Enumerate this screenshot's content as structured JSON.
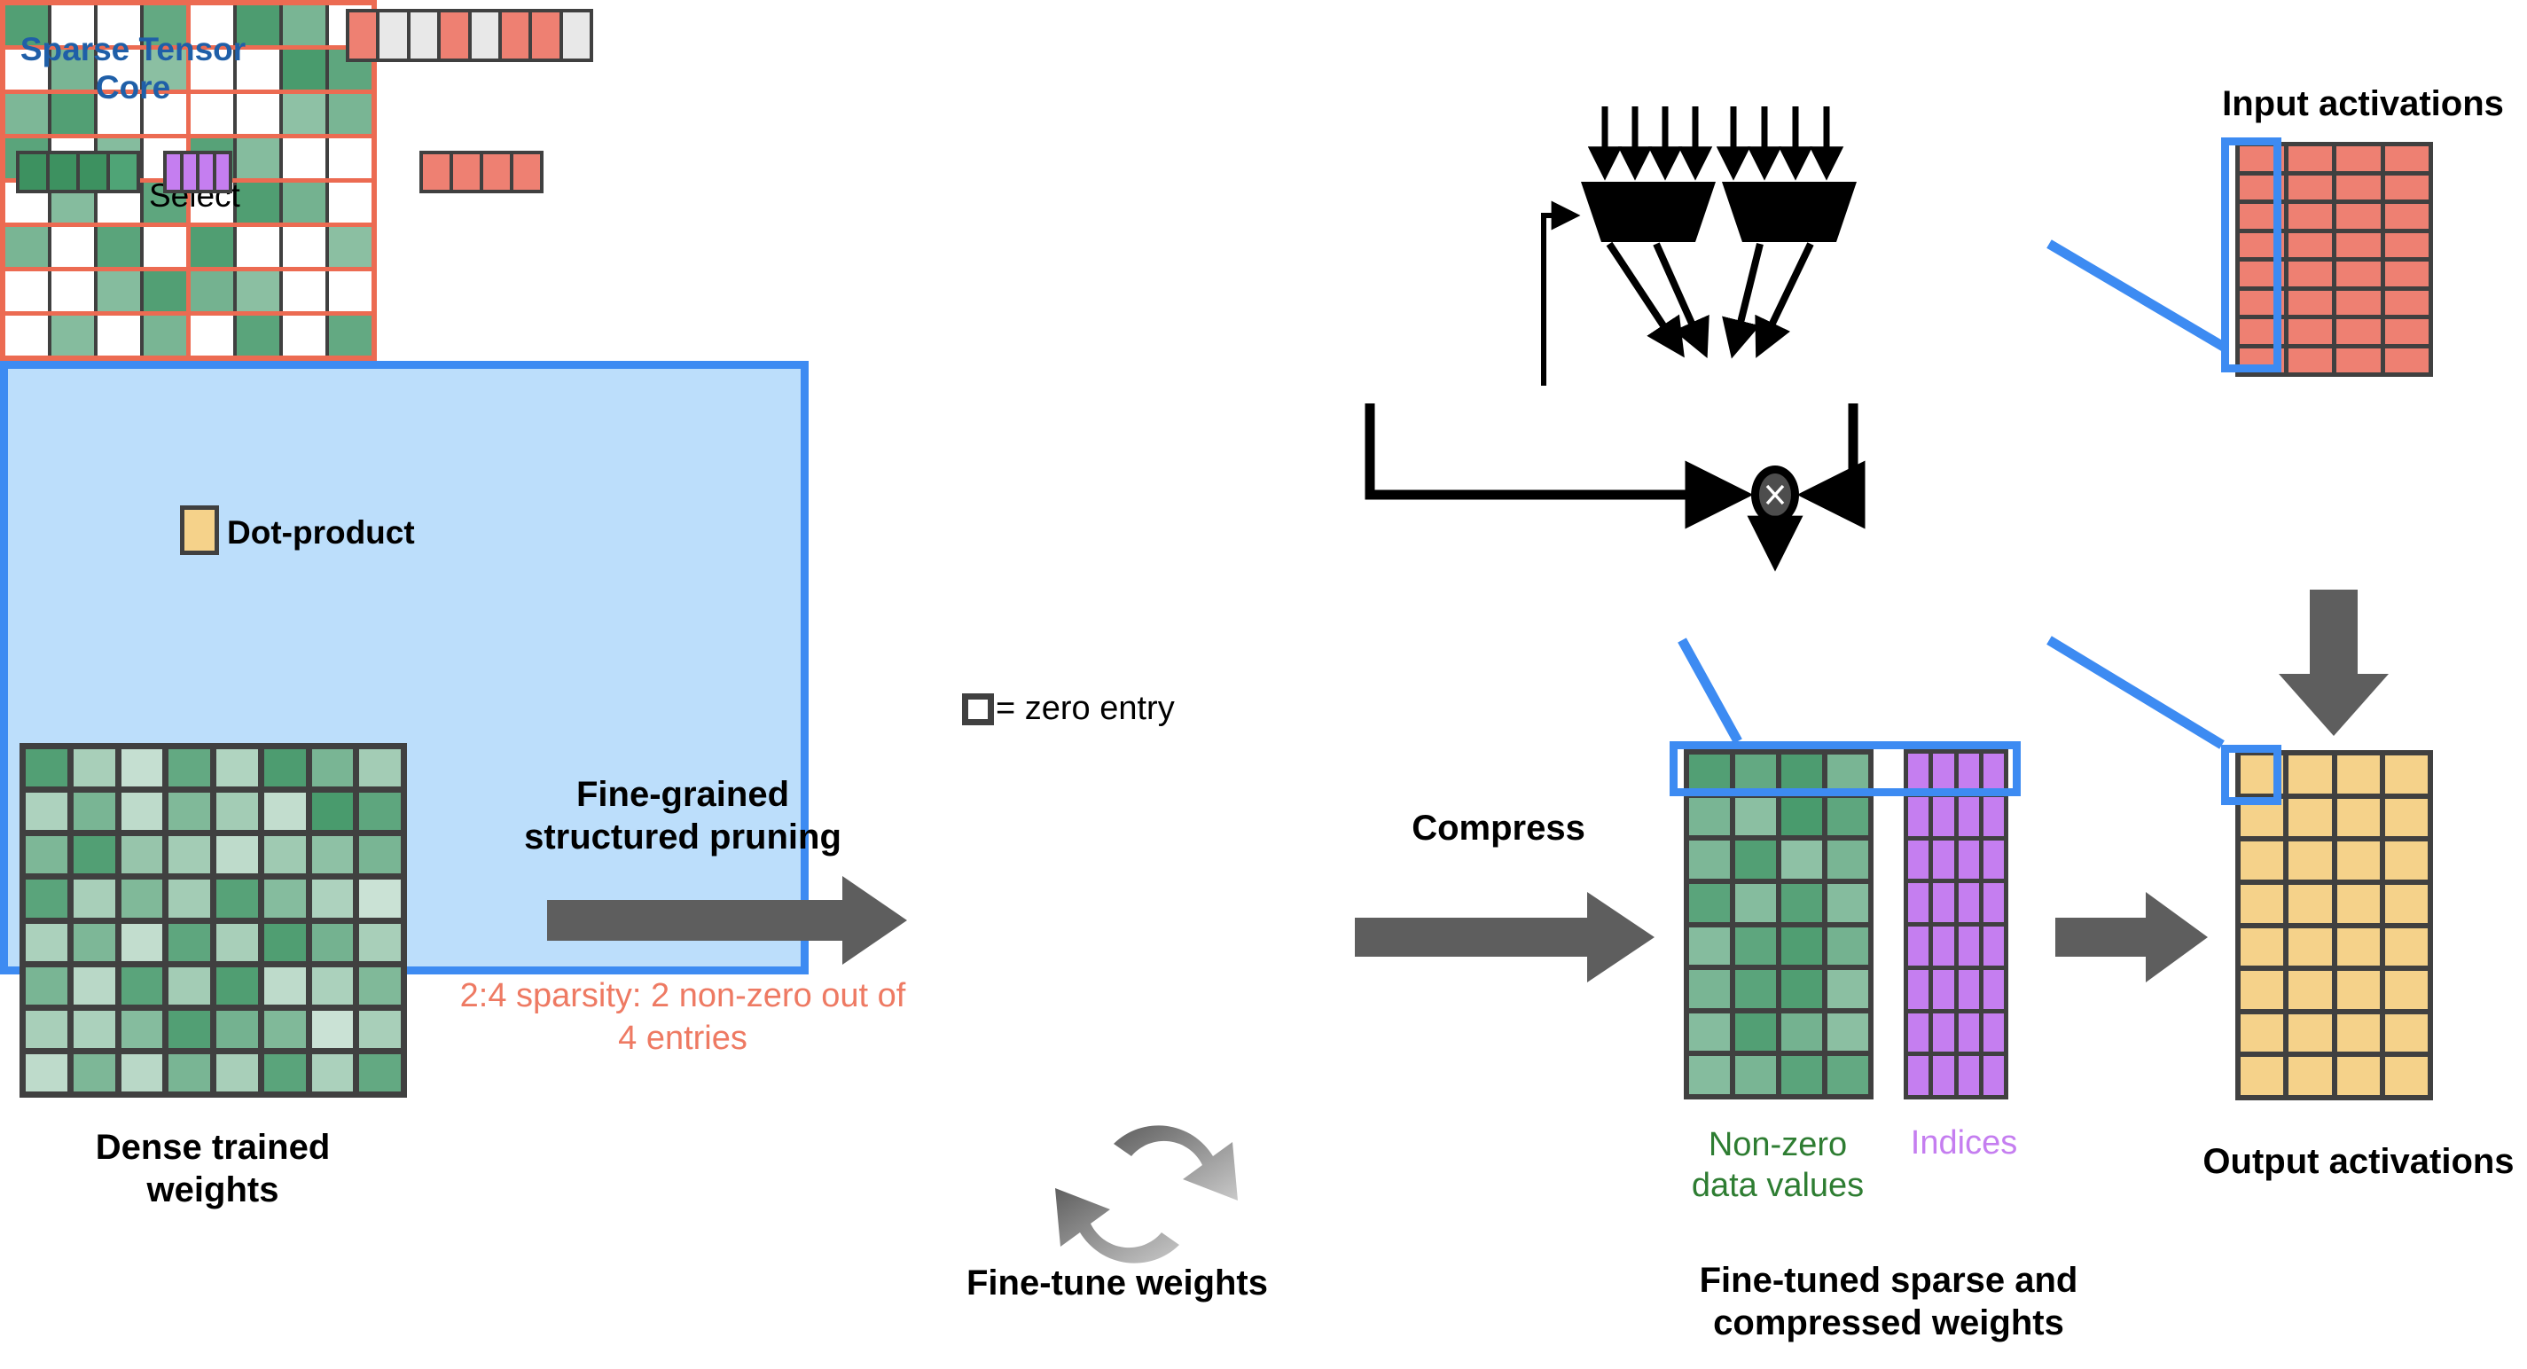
{
  "labels": {
    "dense_weights": "Dense trained\nweights",
    "pruning": "Fine-grained\nstructured pruning",
    "sparsity_note": "2:4 sparsity: 2 non-zero out of 4 entries",
    "compress": "Compress",
    "fine_tune": "Fine-tune weights",
    "zero_entry": "= zero entry",
    "non_zero": "Non-zero\ndata values",
    "indices": "Indices",
    "fine_tuned_sparse": "Fine-tuned sparse and\ncompressed weights",
    "input_activations": "Input activations",
    "output_activations": "Output activations"
  },
  "sparse_tensor_core": {
    "title": "Sparse Tensor\nCore",
    "select": "Select",
    "dot_product": "Dot-product",
    "input_lanes": [
      "red",
      "gray",
      "gray",
      "red",
      "gray",
      "red",
      "red",
      "gray"
    ],
    "mux_count": 2,
    "value_register_cells": 4,
    "index_register_cells": 4,
    "selected_register_cells": 4,
    "multiply_symbol": "×"
  },
  "colors": {
    "panel_fill": "#bcdefb",
    "panel_border": "#3d8bf2",
    "panel_title": "#1f5fa8",
    "green_dark": "#3d9160",
    "green_light": "#d6e9e0",
    "red_cell": "#ee8072",
    "gray_cell": "#e8e8e8",
    "purple": "#c57ef0",
    "yellow": "#f5d28a",
    "grid_border": "#404040",
    "prune_border": "#ec6b52",
    "arrow_gray": "#5e5e5e",
    "nonzero_text": "#2e7d32",
    "sparsity_text": "#ee7a63"
  },
  "matrices": {
    "dense_weights": {
      "rows": 8,
      "cols": 8,
      "values": [
        [
          0.85,
          0.35,
          0.18,
          0.75,
          0.3,
          0.88,
          0.62,
          0.38
        ],
        [
          0.32,
          0.62,
          0.22,
          0.58,
          0.38,
          0.2,
          0.9,
          0.78
        ],
        [
          0.6,
          0.85,
          0.45,
          0.38,
          0.22,
          0.4,
          0.5,
          0.62
        ],
        [
          0.8,
          0.35,
          0.58,
          0.38,
          0.82,
          0.55,
          0.32,
          0.15
        ],
        [
          0.33,
          0.6,
          0.2,
          0.78,
          0.35,
          0.86,
          0.65,
          0.35
        ],
        [
          0.62,
          0.25,
          0.8,
          0.38,
          0.86,
          0.22,
          0.33,
          0.58
        ],
        [
          0.35,
          0.33,
          0.55,
          0.85,
          0.65,
          0.58,
          0.15,
          0.35
        ],
        [
          0.22,
          0.6,
          0.25,
          0.62,
          0.35,
          0.8,
          0.33,
          0.75
        ]
      ]
    },
    "pruned_weights": {
      "rows": 8,
      "cols": 8,
      "note": "2:4 structured sparsity, null = zero entry",
      "values": [
        [
          0.85,
          null,
          null,
          0.75,
          null,
          0.88,
          0.62,
          null
        ],
        [
          null,
          0.62,
          null,
          0.52,
          null,
          null,
          0.9,
          0.78
        ],
        [
          0.6,
          0.85,
          null,
          null,
          null,
          null,
          0.5,
          0.62
        ],
        [
          0.8,
          null,
          0.55,
          null,
          0.82,
          0.55,
          null,
          null
        ],
        [
          null,
          0.55,
          null,
          0.78,
          null,
          0.86,
          0.65,
          null
        ],
        [
          0.62,
          null,
          0.8,
          null,
          0.86,
          null,
          null,
          0.52
        ],
        [
          null,
          null,
          0.55,
          0.85,
          0.65,
          0.52,
          null,
          null
        ],
        [
          null,
          0.55,
          null,
          0.62,
          null,
          0.8,
          null,
          0.75
        ]
      ]
    },
    "compressed_values": {
      "rows": 8,
      "cols": 4,
      "values": [
        [
          0.85,
          0.75,
          0.88,
          0.62
        ],
        [
          0.62,
          0.52,
          0.9,
          0.78
        ],
        [
          0.6,
          0.85,
          0.5,
          0.62
        ],
        [
          0.8,
          0.55,
          0.82,
          0.55
        ],
        [
          0.55,
          0.78,
          0.86,
          0.65
        ],
        [
          0.62,
          0.8,
          0.86,
          0.52
        ],
        [
          0.55,
          0.85,
          0.65,
          0.52
        ],
        [
          0.55,
          0.62,
          0.8,
          0.75
        ]
      ]
    },
    "indices": {
      "rows": 8,
      "cols": 4
    },
    "input_activations": {
      "rows": 8,
      "cols": 4
    },
    "output_activations": {
      "rows": 8,
      "cols": 4
    }
  }
}
